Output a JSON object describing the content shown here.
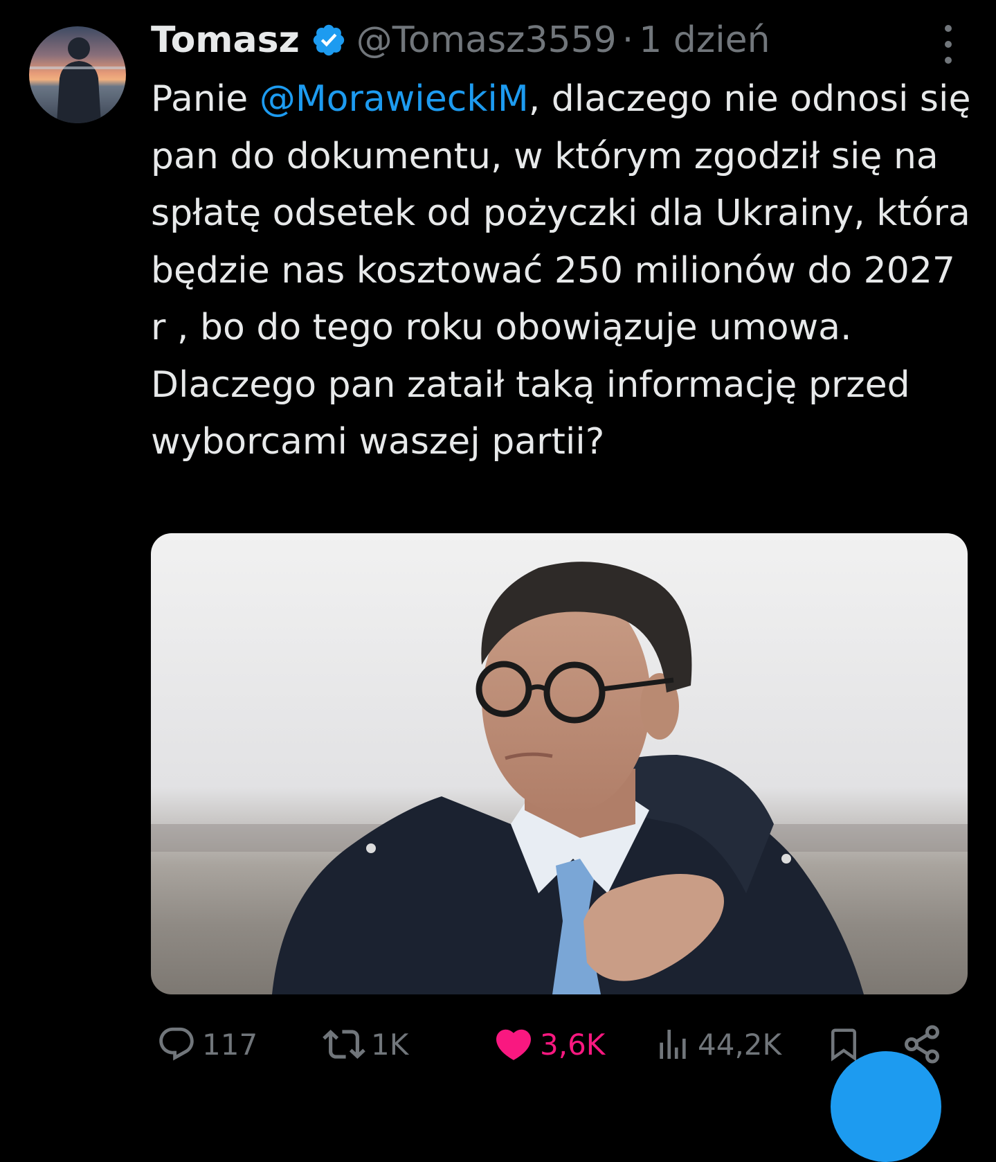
{
  "tweet": {
    "display_name": "Tomasz",
    "handle": "@Tomasz3559",
    "separator": "·",
    "time": "1 dzień",
    "text_prefix": "Panie ",
    "mention": "@MorawieckiM",
    "text_rest": ", dlaczego nie odnosi się pan do dokumentu, w którym zgodził się na spłatę odsetek od pożyczki dla Ukrainy, która będzie nas kosztować 250 milionów do 2027 r , bo do tego roku obowiązuje umowa. Dlaczego pan zataił taką informację przed wyborcami waszej partii?"
  },
  "actions": {
    "replies": "117",
    "reposts": "1K",
    "likes": "3,6K",
    "views": "44,2K"
  },
  "colors": {
    "background": "#000000",
    "text": "#e7e9ea",
    "muted": "#71767b",
    "accent": "#1d9bf0",
    "like": "#f91880"
  },
  "icons": [
    "verified-badge-icon",
    "more-icon",
    "reply-icon",
    "repost-icon",
    "like-icon",
    "views-icon",
    "bookmark-icon",
    "share-icon"
  ]
}
